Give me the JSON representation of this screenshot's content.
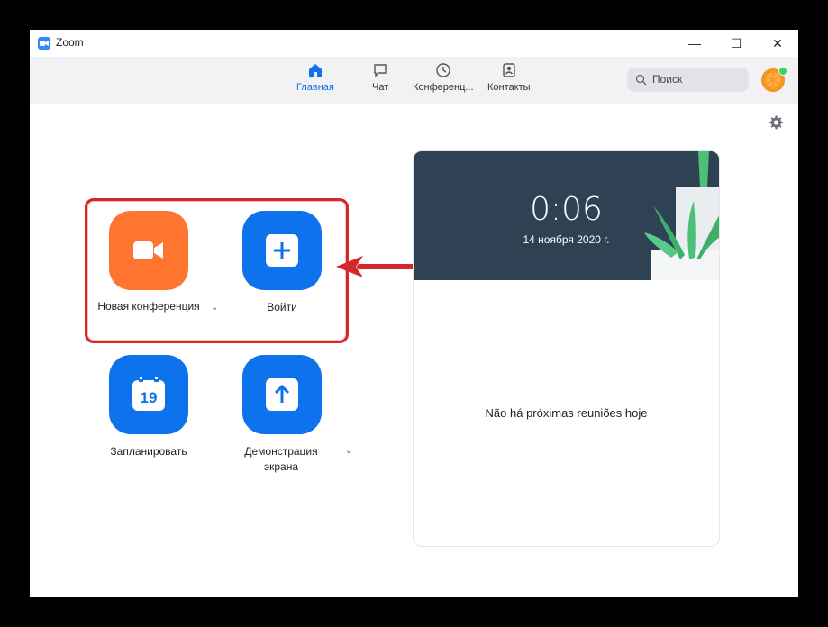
{
  "window": {
    "title": "Zoom",
    "min_glyph": "—",
    "max_glyph": "☐",
    "close_glyph": "✕"
  },
  "nav": {
    "items": [
      {
        "label": "Главная",
        "icon": "home-icon",
        "active": true
      },
      {
        "label": "Чат",
        "icon": "chat-icon",
        "active": false
      },
      {
        "label": "Конференц...",
        "icon": "clock-icon",
        "active": false
      },
      {
        "label": "Контакты",
        "icon": "contacts-icon",
        "active": false
      }
    ],
    "search_placeholder": "Поиск"
  },
  "actions": {
    "new_meeting": "Новая конференция",
    "join": "Войти",
    "schedule": "Запланировать",
    "schedule_day": "19",
    "share_screen": "Демонстрация экрана"
  },
  "panel": {
    "time": "0:06",
    "date": "14 ноября 2020 г.",
    "empty_text": "Não há próximas reuniões hoje"
  },
  "colors": {
    "accent": "#0E72ED",
    "orange": "#FF742E",
    "highlight": "#D6262B"
  }
}
